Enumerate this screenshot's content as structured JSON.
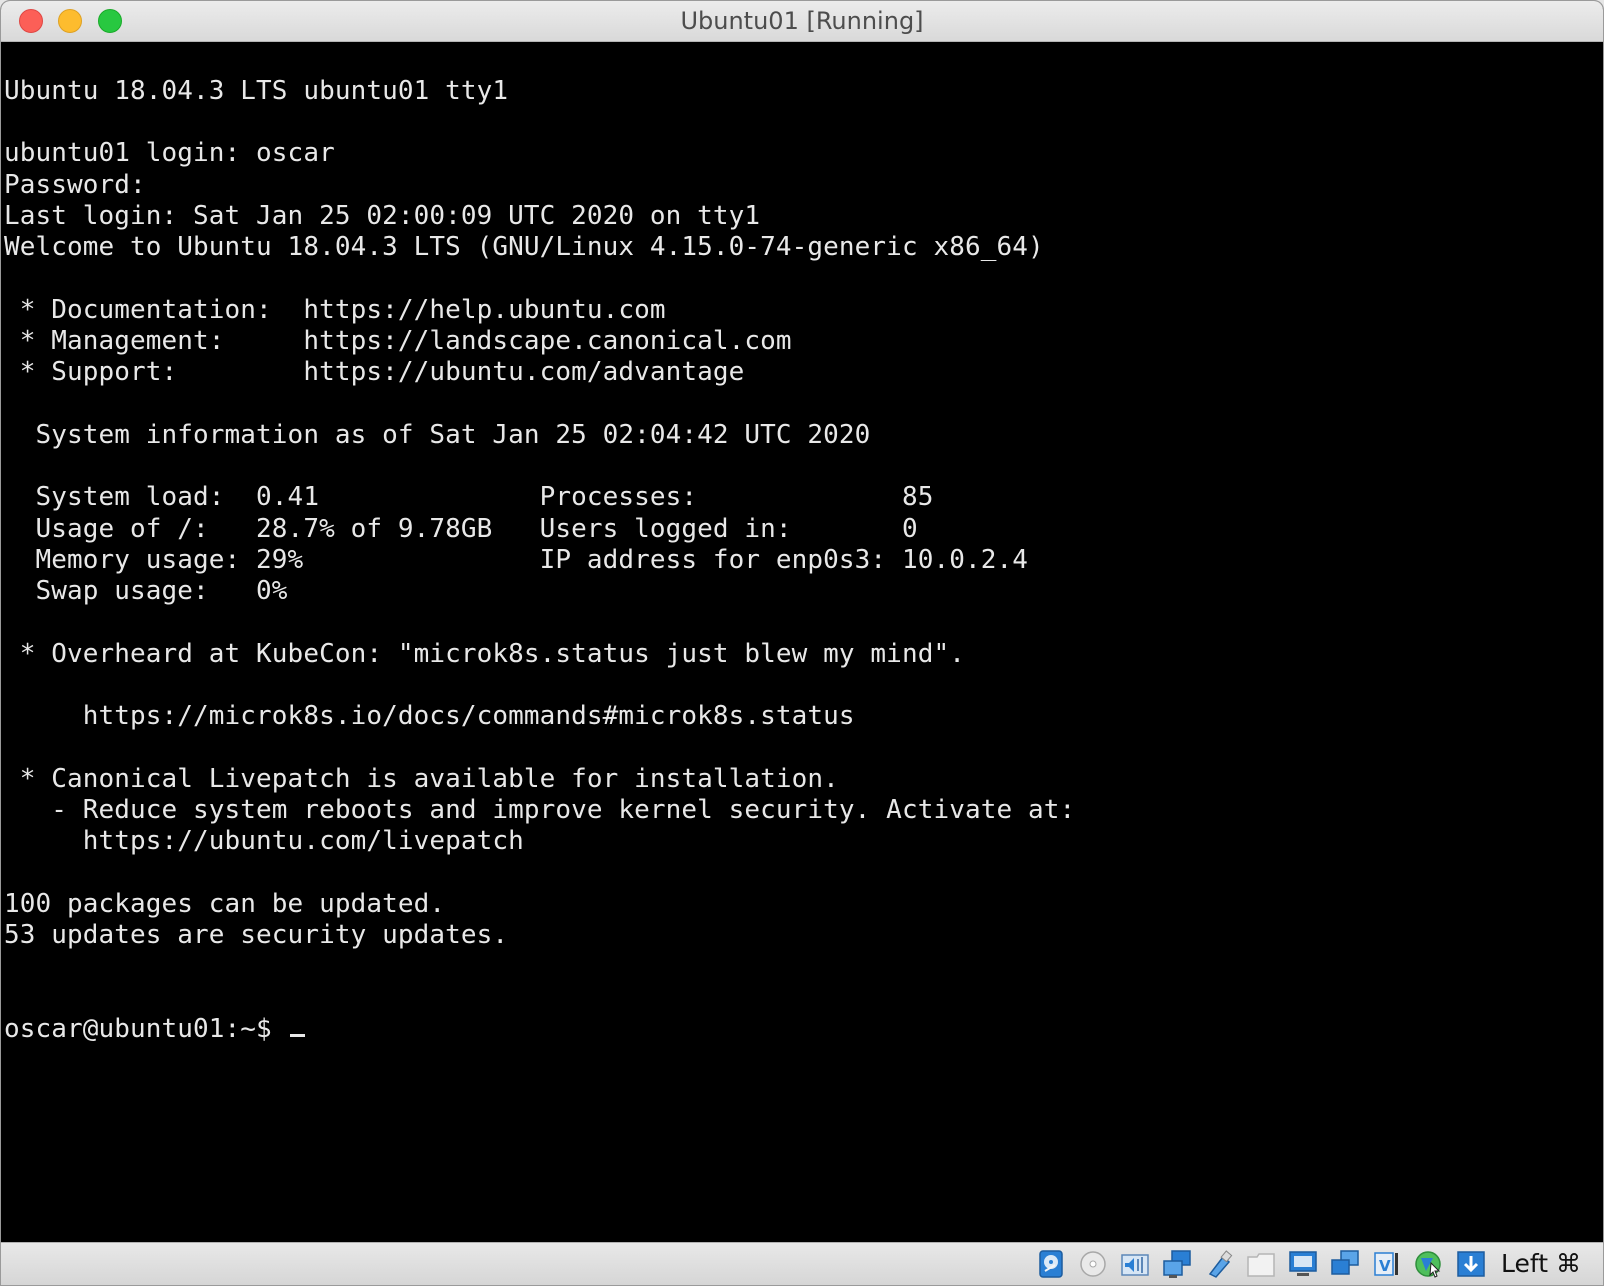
{
  "window": {
    "title": "Ubuntu01 [Running]"
  },
  "console": {
    "lines": [
      "Ubuntu 18.04.3 LTS ubuntu01 tty1",
      "ubuntu01 login: oscar",
      "Password:",
      "Last login: Sat Jan 25 02:00:09 UTC 2020 on tty1",
      "Welcome to Ubuntu 18.04.3 LTS (GNU/Linux 4.15.0-74-generic x86_64)",
      " * Documentation:  https://help.ubuntu.com",
      " * Management:     https://landscape.canonical.com",
      " * Support:        https://ubuntu.com/advantage",
      "  System information as of Sat Jan 25 02:04:42 UTC 2020",
      "  System load:  0.41              Processes:             85",
      "  Usage of /:   28.7% of 9.78GB   Users logged in:       0",
      "  Memory usage: 29%               IP address for enp0s3: 10.0.2.4",
      "  Swap usage:   0%",
      " * Overheard at KubeCon: \"microk8s.status just blew my mind\".",
      "     https://microk8s.io/docs/commands#microk8s.status",
      " * Canonical Livepatch is available for installation.",
      "   - Reduce system reboots and improve kernel security. Activate at:",
      "     https://ubuntu.com/livepatch",
      "100 packages can be updated.",
      "53 updates are security updates.",
      "oscar@ubuntu01:~$ "
    ]
  },
  "statusbar": {
    "icons": [
      "hard-disk-icon",
      "optical-drive-icon",
      "audio-icon",
      "network-icon",
      "usb-icon",
      "shared-folder-icon",
      "display-icon",
      "snapshot-icon",
      "virtualization-icon",
      "mouse-integration-icon",
      "keyboard-capture-icon"
    ],
    "host_key": "Left ⌘"
  },
  "colors": {
    "console_bg": "#000000",
    "console_fg": "#e8e8e8",
    "close": "#fc5f57",
    "minimize": "#fdbc2e",
    "zoom": "#28c840"
  }
}
